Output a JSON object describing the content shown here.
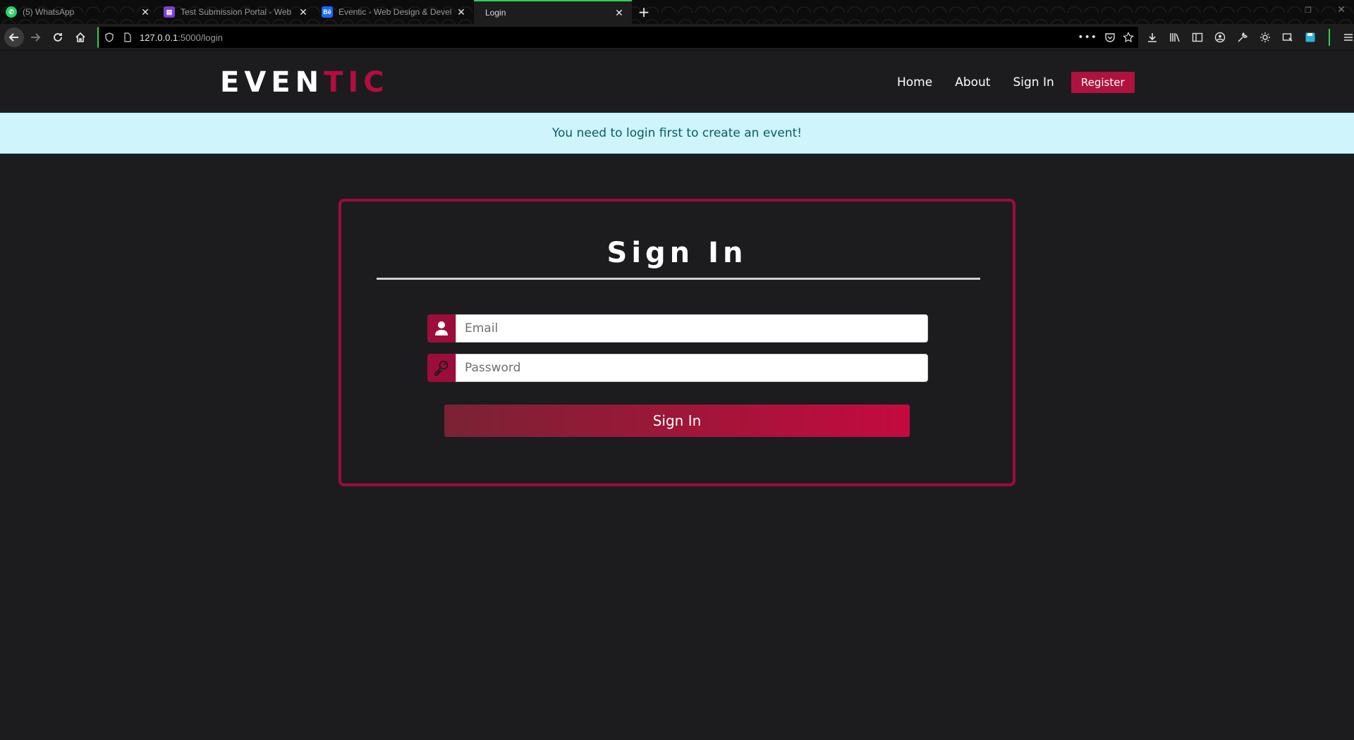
{
  "browser": {
    "tabs": [
      {
        "title": "(5) WhatsApp",
        "favicon": "whatsapp-icon"
      },
      {
        "title": "Test Submission Portal - Web",
        "favicon": "portal-icon"
      },
      {
        "title": "Eventic - Web Design & Devel",
        "favicon": "behance-icon",
        "favicon_text": "Bē"
      },
      {
        "title": "Login",
        "favicon": "none",
        "active": true
      }
    ],
    "url_host": "127.0.0.1",
    "url_path": ":5000/login"
  },
  "site": {
    "logo_main": "EVEN",
    "logo_accent": "TIC",
    "nav": {
      "home": "Home",
      "about": "About",
      "signin": "Sign In",
      "register": "Register"
    },
    "alert": "You need to login first to create an event!",
    "form": {
      "title": "Sign In",
      "email_placeholder": "Email",
      "password_placeholder": "Password",
      "submit_label": "Sign In"
    }
  },
  "colors": {
    "accent": "#b0123e",
    "background": "#1c1c1f",
    "alert_bg": "#cff4fb",
    "alert_text": "#0b5a68"
  }
}
